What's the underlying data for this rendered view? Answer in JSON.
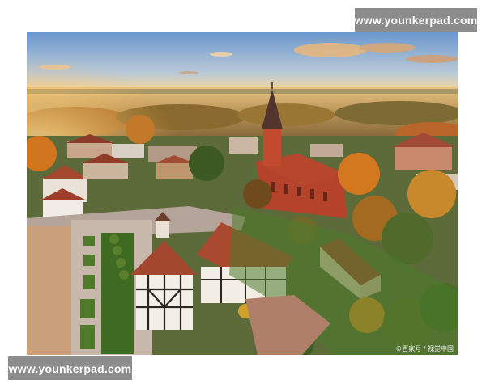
{
  "watermark": {
    "top_text": "www.younkerpad.com",
    "bottom_text": "www.younkerpad.com"
  },
  "photo": {
    "credit": "©百家号 / 视觉中国"
  },
  "colors": {
    "sky_top": "#6b9ad0",
    "sky_horizon": "#f2d7a1",
    "church_brick": "#b5432c",
    "roof_tile": "#a4472f",
    "foliage_autumn": "#d4781f",
    "grass": "#4f7a2a"
  }
}
